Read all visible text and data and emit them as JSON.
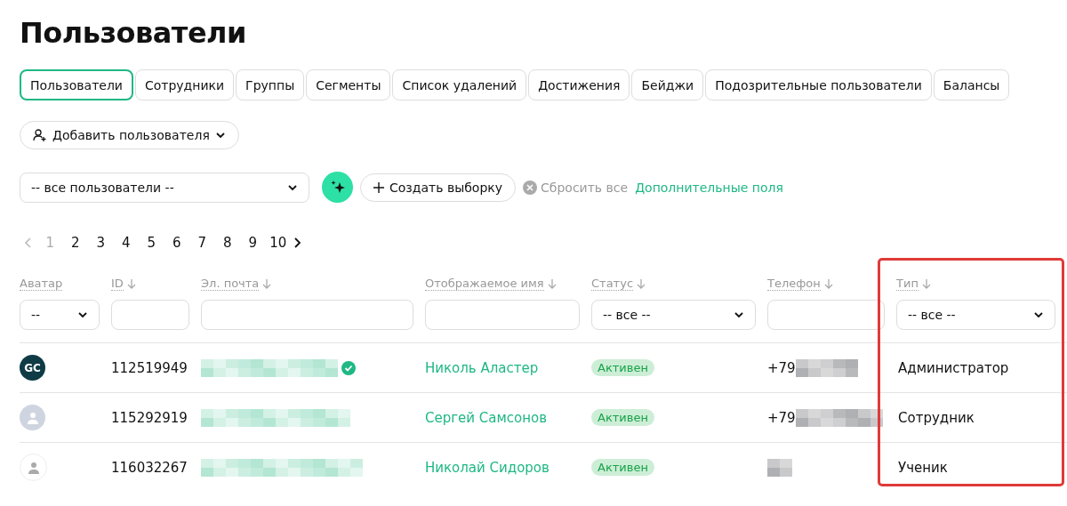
{
  "title": "Пользователи",
  "tabs": [
    {
      "label": "Пользователи",
      "selected": true
    },
    {
      "label": "Сотрудники",
      "selected": false
    },
    {
      "label": "Группы",
      "selected": false
    },
    {
      "label": "Сегменты",
      "selected": false
    },
    {
      "label": "Список удалений",
      "selected": false
    },
    {
      "label": "Достижения",
      "selected": false
    },
    {
      "label": "Бейджи",
      "selected": false
    },
    {
      "label": "Подозрительные пользователи",
      "selected": false
    },
    {
      "label": "Балансы",
      "selected": false
    }
  ],
  "add_button": "Добавить пользователя",
  "filters": {
    "segment_select": "-- все пользователи --",
    "create_button": "Создать выборку",
    "reset": "Сбросить все",
    "extra_fields": "Дополнительные поля"
  },
  "pagination": {
    "pages": [
      {
        "label": "1",
        "selected": true
      },
      {
        "label": "2",
        "selected": false
      },
      {
        "label": "3",
        "selected": false
      },
      {
        "label": "4",
        "selected": false
      },
      {
        "label": "5",
        "selected": false
      },
      {
        "label": "6",
        "selected": false
      },
      {
        "label": "7",
        "selected": false
      },
      {
        "label": "8",
        "selected": false
      },
      {
        "label": "9",
        "selected": false
      },
      {
        "label": "10",
        "selected": false
      }
    ]
  },
  "table": {
    "columns": [
      {
        "label": "Аватар",
        "sortable": false,
        "filter": {
          "kind": "select",
          "value": "--"
        }
      },
      {
        "label": "ID",
        "sortable": true,
        "filter": {
          "kind": "input"
        }
      },
      {
        "label": "Эл. почта",
        "sortable": true,
        "filter": {
          "kind": "input"
        }
      },
      {
        "label": "Отображаемое имя",
        "sortable": true,
        "filter": {
          "kind": "input"
        }
      },
      {
        "label": "Статус",
        "sortable": true,
        "filter": {
          "kind": "select",
          "value": "-- все --"
        }
      },
      {
        "label": "Телефон",
        "sortable": true,
        "filter": {
          "kind": "input"
        }
      },
      {
        "label": "Тип",
        "sortable": true,
        "filter": {
          "kind": "select",
          "value": "-- все --"
        }
      }
    ],
    "rows": [
      {
        "avatar": {
          "kind": "logo",
          "text": "GC"
        },
        "id": "112519949",
        "verified": true,
        "name": "Николь Аластер",
        "status": "Активен",
        "phone_prefix": "+79"
      },
      {
        "avatar": {
          "kind": "gray"
        },
        "id": "115292919",
        "verified": false,
        "name": "Сергей Самсонов",
        "status": "Активен",
        "phone_prefix": "+79"
      },
      {
        "avatar": {
          "kind": "light"
        },
        "id": "116032267",
        "verified": false,
        "name": "Николай Сидоров",
        "status": "Активен"
      }
    ],
    "type_menu": [
      "Администратор",
      "Сотрудник",
      "Ученик"
    ]
  }
}
